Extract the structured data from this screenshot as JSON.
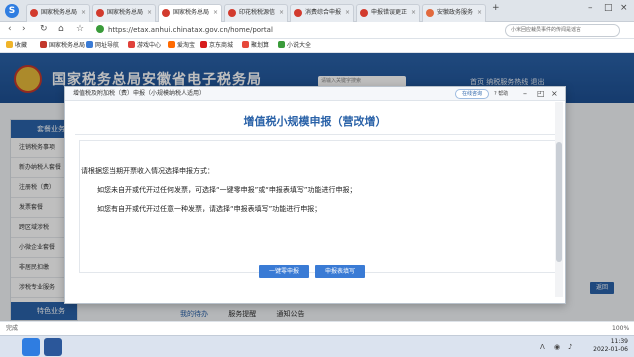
{
  "browser": {
    "tabs": [
      {
        "label": "国家税务总局"
      },
      {
        "label": "国家税务总局"
      },
      {
        "label": "国家税务总局"
      },
      {
        "label": "印花税税源信"
      },
      {
        "label": "消费综合申报"
      },
      {
        "label": "申报错误更正"
      },
      {
        "label": "安徽政务服务"
      }
    ],
    "url": "https://etax.anhui.chinatax.gov.cn/home/portal",
    "search_placeholder": "小米回应裁员事件的传闻是谣言",
    "bookmarks": [
      "收藏",
      "国家税务总局",
      "网址导航",
      "游戏中心",
      "爱淘宝",
      "京东商城",
      "聚划算",
      "小说大全"
    ],
    "status_left": "完成",
    "zoom": "100%"
  },
  "site": {
    "title": "国家税务总局安徽省电子税务局",
    "search_placeholder": "请输入关键字搜索",
    "tools": "首页  纳税服务热线  退出",
    "side_head": "套餐业务",
    "side_items": [
      "注销税务事项",
      "新办纳税人套餐",
      "注册税（费）",
      "发票套餐",
      "跨区域涉税",
      "小微企业套餐",
      "非居民扣缴",
      "涉税专业服务"
    ],
    "side_foot": "特色业务",
    "bottom_tabs": [
      "我的待办",
      "服务提醒",
      "通知公告"
    ],
    "back_label": "返回"
  },
  "modal": {
    "breadcrumb": "增值税及附加税（费）申报（小规模纳税人适用）",
    "online_label": "在线咨询",
    "help_label": "帮助",
    "heading": "增值税小规模申报（营改增）",
    "intro": "请根据您当期开票收入情况选择申报方式：",
    "line1": "如您未自开或代开过任何发票，可选择“一键零申报”或“申报表填写”功能进行申报；",
    "line2": "如您有自开或代开过任意一种发票，请选择“申报表填写”功能进行申报；",
    "btn_zero": "一键零申报",
    "btn_fill": "申报表填写"
  },
  "taskbar": {
    "time": "11:39",
    "date": "2022-01-06"
  }
}
